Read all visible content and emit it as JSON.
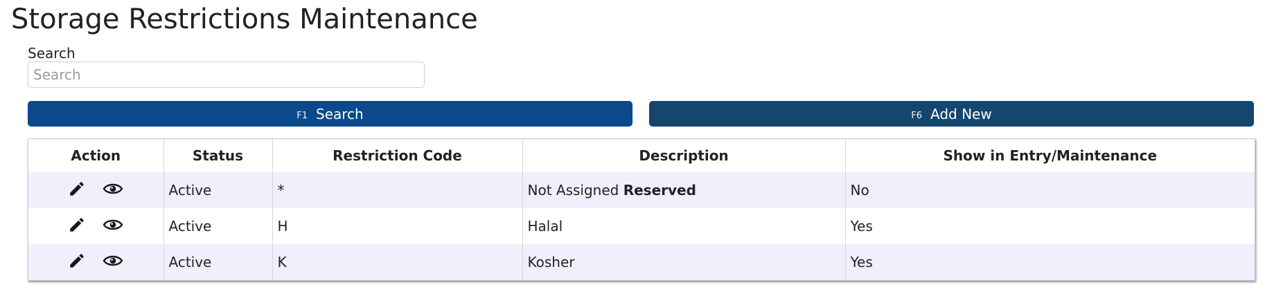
{
  "page": {
    "title": "Storage Restrictions Maintenance"
  },
  "search": {
    "label": "Search",
    "placeholder": "Search",
    "value": ""
  },
  "buttons": {
    "search": {
      "key": "F1",
      "label": "Search",
      "color": "#0a4a8c"
    },
    "add_new": {
      "key": "F6",
      "label": "Add New",
      "color": "#15466e"
    }
  },
  "table": {
    "columns": [
      "Action",
      "Status",
      "Restriction Code",
      "Description",
      "Show in Entry/Maintenance"
    ],
    "rows": [
      {
        "status": "Active",
        "code": "*",
        "description": "Not Assigned",
        "description_bold": "Reserved",
        "show": "No"
      },
      {
        "status": "Active",
        "code": "H",
        "description": "Halal",
        "description_bold": "",
        "show": "Yes"
      },
      {
        "status": "Active",
        "code": "K",
        "description": "Kosher",
        "description_bold": "",
        "show": "Yes"
      }
    ],
    "row_actions": [
      "pencil-icon",
      "eye-icon"
    ],
    "striped_row_color": "#eff0fb"
  }
}
